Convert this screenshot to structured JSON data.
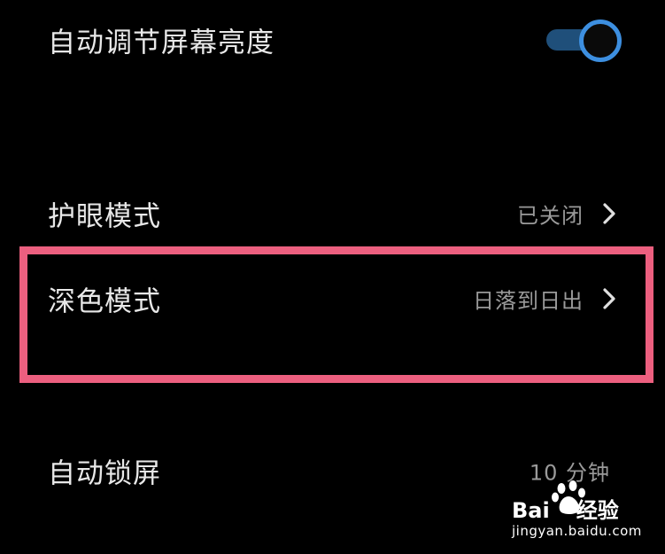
{
  "settings": {
    "auto_brightness": {
      "label": "自动调节屏幕亮度",
      "enabled": true,
      "toggle_color": "#3d8fe0"
    },
    "eye_comfort": {
      "label": "护眼模式",
      "value": "已关闭"
    },
    "dark_mode": {
      "label": "深色模式",
      "value": "日落到日出"
    },
    "auto_lock": {
      "label": "自动锁屏",
      "value": "10  分钟"
    }
  },
  "annotation": {
    "highlight_color": "#ec5f7f"
  },
  "watermark": {
    "brand_left": "Bai",
    "brand_right": "经验",
    "url": "jingyan.baidu.com"
  }
}
